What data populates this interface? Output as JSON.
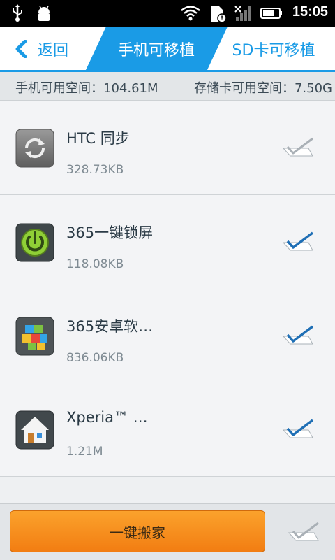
{
  "status_bar": {
    "time": "15:05"
  },
  "header": {
    "back_label": "返回",
    "tab_active": "手机可移植",
    "tab_sd": "SD卡可移植"
  },
  "space": {
    "phone": "手机可用空间：104.61M",
    "sd": "存储卡可用空间：7.50G"
  },
  "apps": [
    {
      "name": "HTC 同步",
      "size": "328.73KB",
      "checked": false
    },
    {
      "name": "365一键锁屏",
      "size": "118.08KB",
      "checked": true
    },
    {
      "name": "365安卓软…",
      "size": "836.06KB",
      "checked": true
    },
    {
      "name": "Xperia™ …",
      "size": "1.21M",
      "checked": true
    }
  ],
  "bottom": {
    "button_label": "一键搬家"
  },
  "colors": {
    "accent": "#1a9be6",
    "button": "#f58a1a"
  },
  "icons": [
    "usb-icon",
    "android-icon",
    "wifi-icon",
    "sd-card-icon",
    "signal-icon",
    "battery-icon",
    "back-arrow-icon",
    "sync-icon",
    "power-icon",
    "blocks-icon",
    "home-icon",
    "checkmark-icon"
  ]
}
